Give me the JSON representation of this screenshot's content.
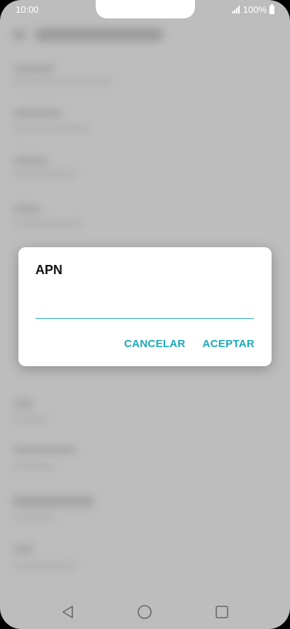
{
  "status_bar": {
    "time": "10:00",
    "battery": "100%"
  },
  "dialog": {
    "title": "APN",
    "input_value": "",
    "cancel_label": "CANCELAR",
    "accept_label": "ACEPTAR"
  },
  "nav": {
    "back": "back-icon",
    "home": "home-icon",
    "recents": "recents-icon"
  },
  "colors": {
    "accent": "#1aa9b8",
    "underline": "#2ab0bf",
    "scrim": "#bdbdbd"
  }
}
